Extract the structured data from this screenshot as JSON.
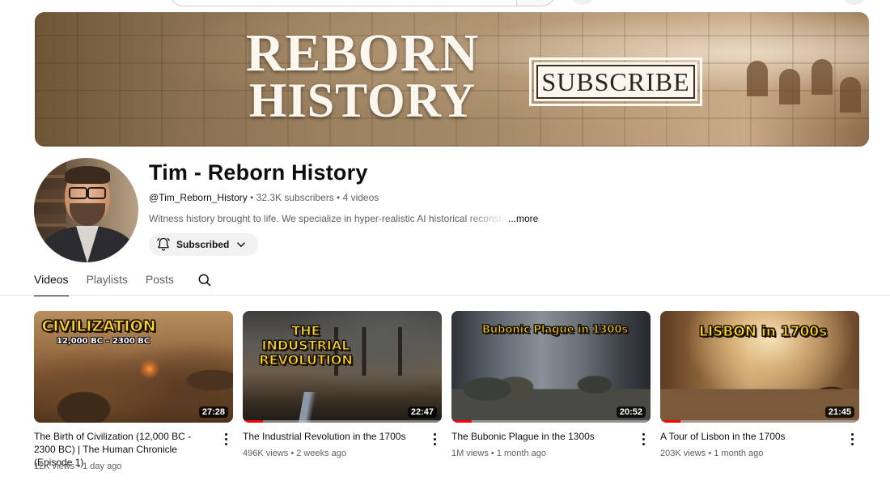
{
  "banner": {
    "title_line1": "REBORN",
    "title_line2": "HISTORY",
    "subscribe_label": "SUBSCRIBE"
  },
  "channel": {
    "name": "Tim - Reborn History",
    "handle": "@Tim_Reborn_History",
    "subscribers": "32.3K subscribers",
    "video_count": "4 videos",
    "separator": " • ",
    "description": "Witness history brought to life. We specialize in hyper-realistic AI historical reconstructions",
    "more_label": "...more",
    "subscribed_label": "Subscribed"
  },
  "tabs": [
    {
      "label": "Videos",
      "active": true
    },
    {
      "label": "Playlists",
      "active": false
    },
    {
      "label": "Posts",
      "active": false
    }
  ],
  "icons": {
    "tab_search": "search-icon",
    "bell": "bell-icon",
    "chevron": "chevron-down-icon",
    "kebab": "more-vert-icon"
  },
  "colors": {
    "accent": "#ff0000",
    "thumb_text": "#ffd42a"
  },
  "videos": [
    {
      "title": "The Birth of Civilization (12,000 BC - 2300 BC) | The Human Chronicle (Episode 1)",
      "views": "12K views",
      "age": "1 day ago",
      "duration": "27:28",
      "thumb_headline": "CIVILIZATION",
      "thumb_subhead": "12,000 BC – 2300 BC",
      "progress": 0
    },
    {
      "title": "The Industrial Revolution in the 1700s",
      "views": "496K views",
      "age": "2 weeks ago",
      "duration": "22:47",
      "thumb_headline": "THE INDUSTRIAL REVOLUTION",
      "thumb_subhead": "",
      "progress": 0.1
    },
    {
      "title": "The Bubonic Plague in the 1300s",
      "views": "1M views",
      "age": "1 month ago",
      "duration": "20:52",
      "thumb_headline": "Bubonic Plague in 1300s",
      "thumb_subhead": "",
      "progress": 0.1
    },
    {
      "title": "A Tour of Lisbon in the 1700s",
      "views": "203K views",
      "age": "1 month ago",
      "duration": "21:45",
      "thumb_headline": "LISBON in 1700s",
      "thumb_subhead": "",
      "progress": 0.1
    }
  ]
}
